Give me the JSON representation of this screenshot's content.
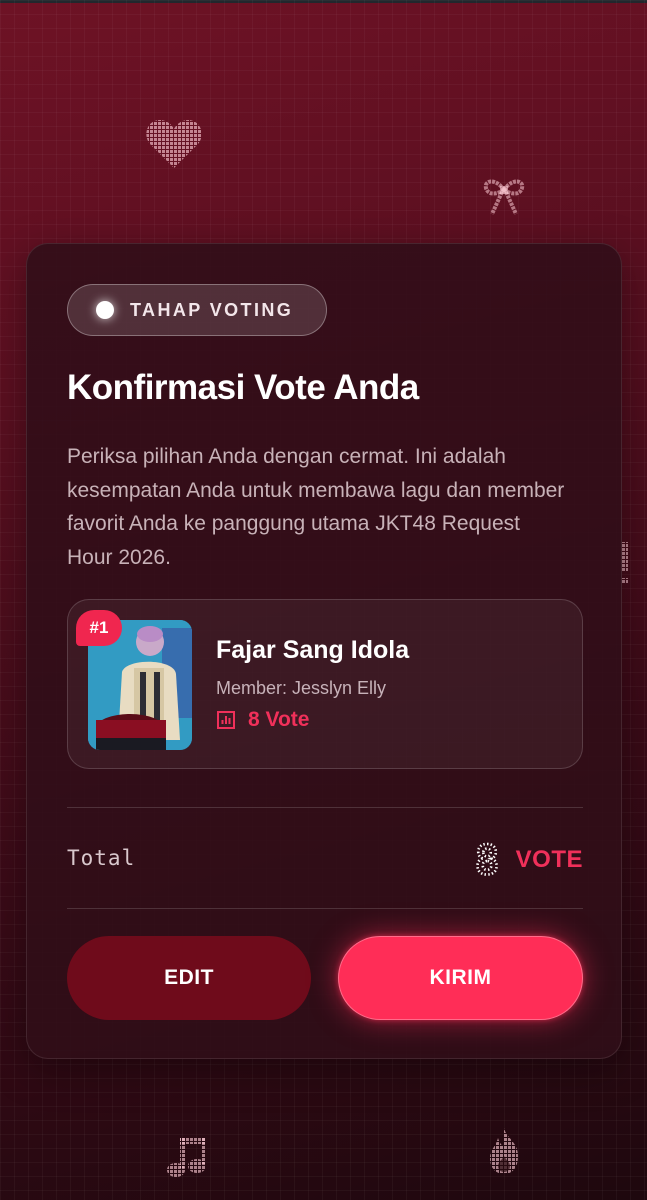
{
  "badge": {
    "label": "TAHAP VOTING"
  },
  "header": {
    "title": "Konfirmasi Vote Anda"
  },
  "description": "Periksa pilihan Anda dengan cermat. Ini adalah kesempatan Anda untuk membawa lagu dan member favorit Anda ke panggung utama JKT48 Request Hour 2026.",
  "selection": {
    "rank": "#1",
    "song": "Fajar Sang Idola",
    "member": "Member: Jesslyn Elly",
    "votes": "8 Vote"
  },
  "total": {
    "label": "Total",
    "value": "8",
    "unit": "VOTE"
  },
  "actions": {
    "edit_label": "EDIT",
    "send_label": "KIRIM"
  },
  "colors": {
    "accent": "#ff2d57",
    "edit_button": "#6f0b1b",
    "background": "#5a0f20"
  },
  "icons": [
    "heart-icon",
    "bow-icon",
    "music-note-icon",
    "fire-icon",
    "bar-chart-icon",
    "exclamation-icon"
  ]
}
